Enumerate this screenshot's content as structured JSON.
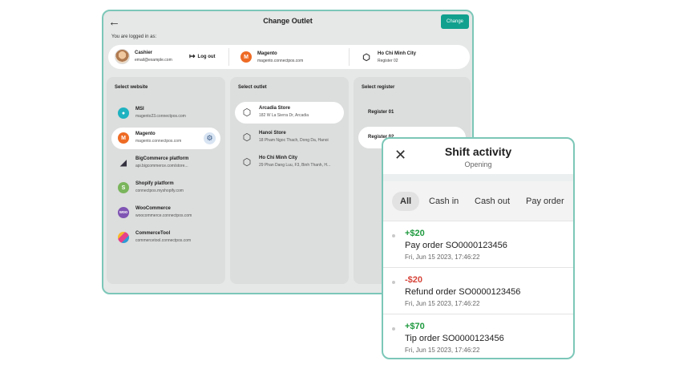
{
  "window": {
    "title": "Change Outlet",
    "change_label": "Change",
    "logged_label": "You are logged in as:"
  },
  "user_bar": {
    "role": "Cashier",
    "email": "email@example.com",
    "logout_label": "Log out",
    "platform_name": "Magento",
    "platform_url": "magento.connectpos.com",
    "location_name": "Ho Chi Minh City",
    "location_register": "Register 02"
  },
  "websites": {
    "header": "Select website",
    "items": [
      {
        "name": "MSI",
        "url": "magento23.connectpos.com",
        "color": "#1fb2c0",
        "icon": "msi-icon"
      },
      {
        "name": "Magento",
        "url": "magento.connectpos.com",
        "color": "#ee6b25",
        "icon": "magento-icon"
      },
      {
        "name": "BigCommerce platform",
        "url": "api.bigcommerce.com/store...",
        "color": "#34313f",
        "icon": "bigcommerce-icon"
      },
      {
        "name": "Shopify platform",
        "url": "connectpos.myshopify.com",
        "color": "#7ab55c",
        "icon": "shopify-icon"
      },
      {
        "name": "WooCommerce",
        "url": "woocommerce.connectpos.com",
        "color": "#7f54b3",
        "icon": "woocommerce-icon"
      },
      {
        "name": "CommerceTool",
        "url": "commercetool.connectpos.com",
        "color": "#f7b72a",
        "icon": "commercetool-icon"
      }
    ]
  },
  "outlets": {
    "header": "Select outlet",
    "items": [
      {
        "name": "Arcadia Store",
        "address": "182 W La Sierra Dr, Arcadia"
      },
      {
        "name": "Hanoi Store",
        "address": "18 Pham Ngoc Thach, Dong Da, Hanoi"
      },
      {
        "name": "Ho Chi Minh City",
        "address": "29 Phan Dang Luu, F3, Binh Thanh, H..."
      }
    ]
  },
  "registers": {
    "header": "Select register",
    "items": [
      "Register 01",
      "Register 02"
    ]
  },
  "shift": {
    "title": "Shift activity",
    "subtitle": "Opening",
    "tabs": [
      "All",
      "Cash in",
      "Cash out",
      "Pay order"
    ],
    "entries": [
      {
        "amount": "+$20",
        "description": "Pay order SO0000123456",
        "time": "Fri, Jun 15 2023, 17:46:22",
        "color": "#1f9a3f"
      },
      {
        "amount": "-$20",
        "description": "Refund order SO0000123456",
        "time": "Fri, Jun 15 2023, 17:46:22",
        "color": "#d6453a"
      },
      {
        "amount": "+$70",
        "description": "Tip order SO0000123456",
        "time": "Fri, Jun 15 2023, 17:46:22",
        "color": "#1f9a3f"
      }
    ]
  }
}
